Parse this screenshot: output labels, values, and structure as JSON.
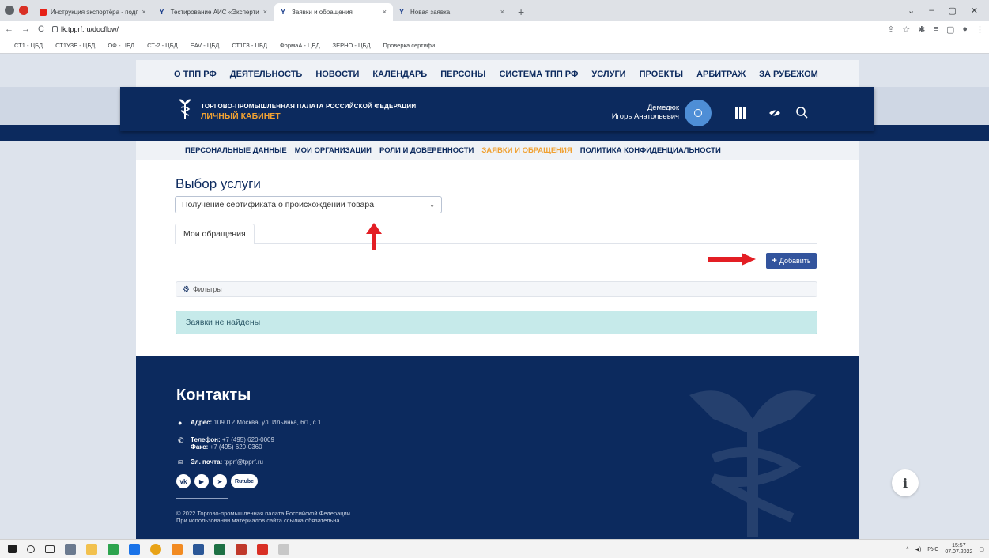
{
  "browser": {
    "tabs": [
      {
        "label": "Инструкция экспортёра - подг",
        "favicon": "youtube"
      },
      {
        "label": "Тестирование АИС «Эксперти",
        "favicon": "tpp"
      },
      {
        "label": "Заявки и обращения",
        "favicon": "tpp",
        "active": true
      },
      {
        "label": "Новая заявка",
        "favicon": "tpp"
      }
    ],
    "close_glyph": "×",
    "new_tab_glyph": "+",
    "window_controls": [
      "⌄",
      "–",
      "▢",
      "✕"
    ],
    "url": "lk.tpprf.ru/docflow/",
    "bookmarks": [
      "СТ1 - ЦБД",
      "СТ1УЗБ - ЦБД",
      "ОФ - ЦБД",
      "СТ-2 - ЦБД",
      "EAV - ЦБД",
      "СТ1ГЗ - ЦБД",
      "ФормаА - ЦБД",
      "ЗЕРНО - ЦБД",
      "Проверка сертифи..."
    ]
  },
  "site": {
    "top_menu": [
      "О ТПП РФ",
      "ДЕЯТЕЛЬНОСТЬ",
      "НОВОСТИ",
      "КАЛЕНДАРЬ",
      "ПЕРСОНЫ",
      "СИСТЕМА ТПП РФ",
      "УСЛУГИ",
      "ПРОЕКТЫ",
      "АРБИТРАЖ",
      "ЗА РУБЕЖОМ"
    ],
    "header": {
      "org_name": "ТОРГОВО-ПРОМЫШЛЕННАЯ ПАЛАТА РОССИЙСКОЙ ФЕДЕРАЦИИ",
      "cabinet": "ЛИЧНЫЙ КАБИНЕТ",
      "user_last_name": "Демедюк",
      "user_first_name": "Игорь Анатольевич"
    },
    "sub_nav": [
      "ПЕРСОНАЛЬНЫЕ ДАННЫЕ",
      "МОИ ОРГАНИЗАЦИИ",
      "РОЛИ И ДОВЕРЕННОСТИ",
      "ЗАЯВКИ И ОБРАЩЕНИЯ",
      "ПОЛИТИКА КОНФИДЕНЦИАЛЬНОСТИ"
    ],
    "sub_nav_active": "ЗАЯВКИ И ОБРАЩЕНИЯ",
    "content": {
      "heading": "Выбор услуги",
      "service_selected": "Получение сертификата о происхождении товара",
      "tab": "Мои обращения",
      "add_button": "Добавить",
      "filters": "Фильтры",
      "empty_message": "Заявки не найдены"
    },
    "footer": {
      "heading": "Контакты",
      "address_label": "Адрес:",
      "address": "109012 Москва, ул. Ильинка, 6/1, с.1",
      "phone_label": "Телефон:",
      "phone": "+7 (495) 620-0009",
      "fax_label": "Факс:",
      "fax": "+7 (495) 620-0360",
      "email_label": "Эл. почта:",
      "email": "tpprf@tpprf.ru",
      "social": [
        "vk",
        "youtube",
        "telegram",
        "Rutube"
      ],
      "rutube_label": "Rutube",
      "copyright_1": "© 2022 Торгово-промышленная палата Российской Федерации",
      "copyright_2": "При использовании материалов сайта ссылка обязательна"
    }
  },
  "taskbar": {
    "lang": "РУС",
    "time": "15:57",
    "date": "07.07.2022"
  },
  "colors": {
    "navy": "#0c2a5e",
    "orange": "#f0a132",
    "button_blue": "#33549d",
    "arrow_red": "#e31e24",
    "info_box": "#c6eaea"
  }
}
